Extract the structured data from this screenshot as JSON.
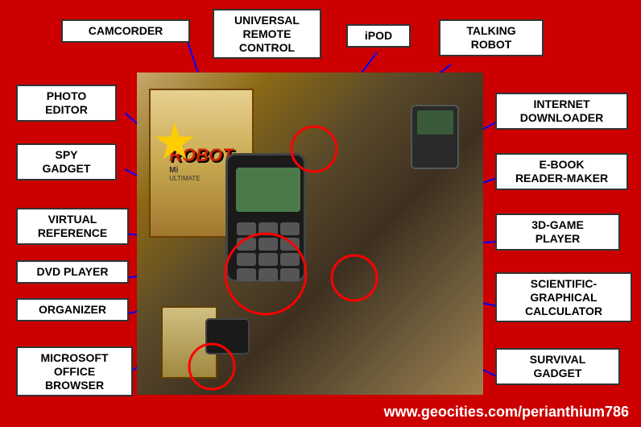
{
  "labels": {
    "camcorder": "CAMCORDER",
    "universal_remote": "UNIVERSAL\nREMOTE\nCONTROL",
    "ipod": "iPOD",
    "talking_robot": "TALKING\nROBOT",
    "photo_editor": "PHOTO\nEDITOR",
    "internet_downloader": "INTERNET\nDOWNLOADER",
    "spy_gadget": "SPY\nGADGET",
    "ebook_reader": "E-BOOK\nREADER-MAKER",
    "virtual_reference": "VIRTUAL\nREFERENCE",
    "game_player": "3D-GAME\nPLAYER",
    "dvd_player": "DVD PLAYER",
    "scientific_calc": "SCIENTIFIC-\nGRAPHICAL\nCALCULATOR",
    "organizer": "ORGANIZER",
    "survival_gadget": "SURVIVAL\nGADGET",
    "ms_office_browser": "MICROSOFT\nOFFICE\nBROWSER",
    "website": "www.geocities.com/perianthium786"
  },
  "colors": {
    "background": "#cc0000",
    "label_bg": "#ffffff",
    "line_color": "#0000ff",
    "circle_color": "#ff0000"
  }
}
